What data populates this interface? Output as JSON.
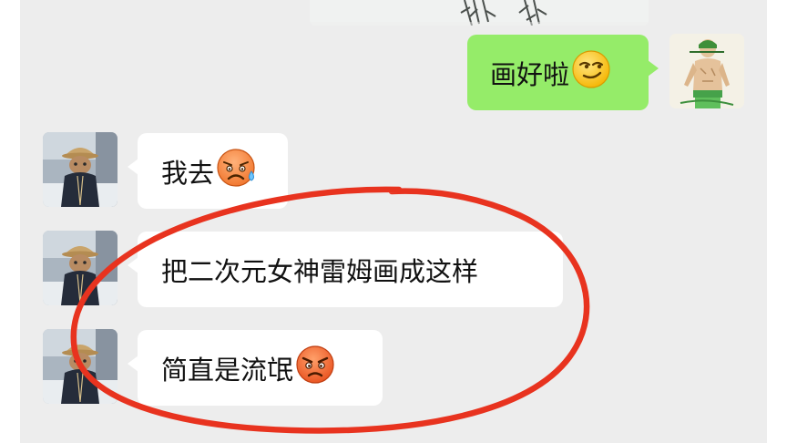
{
  "chat": {
    "messages": [
      {
        "sender": "me",
        "type": "image"
      },
      {
        "sender": "me",
        "type": "text",
        "text": "画好啦",
        "emoji": "smirk-emoji"
      },
      {
        "sender": "friend",
        "type": "text",
        "text": "我去",
        "emoji": "anguished-sweat-emoji"
      },
      {
        "sender": "friend",
        "type": "text",
        "text": "把二次元女神雷姆画成这样",
        "emoji": ""
      },
      {
        "sender": "friend",
        "type": "text",
        "text": "简直是流氓",
        "emoji": "angry-emoji"
      }
    ],
    "colors": {
      "background": "#ededed",
      "outgoing_bubble": "#95ec69",
      "incoming_bubble": "#ffffff",
      "annotation_circle": "#e8331f"
    },
    "avatars": {
      "me": "swordsman-drawing-avatar",
      "friend": "cat-with-straw-hat-avatar"
    }
  }
}
